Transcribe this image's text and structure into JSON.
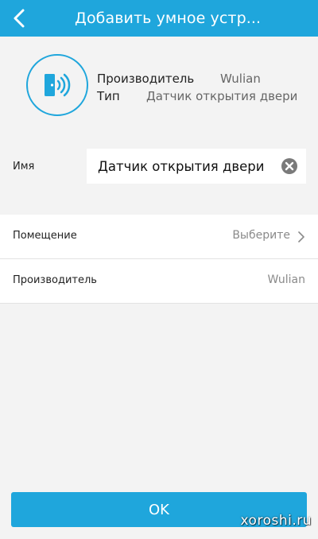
{
  "header": {
    "title": "Добавить умное устр...",
    "back_icon": "chevron-left-icon"
  },
  "device": {
    "icon": "door-sensor-icon",
    "manufacturer_label": "Производитель",
    "manufacturer_value": "Wulian",
    "type_label": "Тип",
    "type_value": "Датчик открытия двери"
  },
  "name_field": {
    "label": "Имя",
    "value": "Датчик открытия двери",
    "clear_icon": "clear-icon"
  },
  "room_row": {
    "label": "Помещение",
    "value": "Выберите",
    "chevron_icon": "chevron-right-icon"
  },
  "manufacturer_row": {
    "label": "Производитель",
    "value": "Wulian"
  },
  "ok_button": {
    "label": "OK"
  },
  "watermark": "xoroshi.ru",
  "colors": {
    "accent": "#1fa6dc",
    "background": "#f3f3f3",
    "card": "#ffffff",
    "muted_text": "#8a8a8a"
  }
}
